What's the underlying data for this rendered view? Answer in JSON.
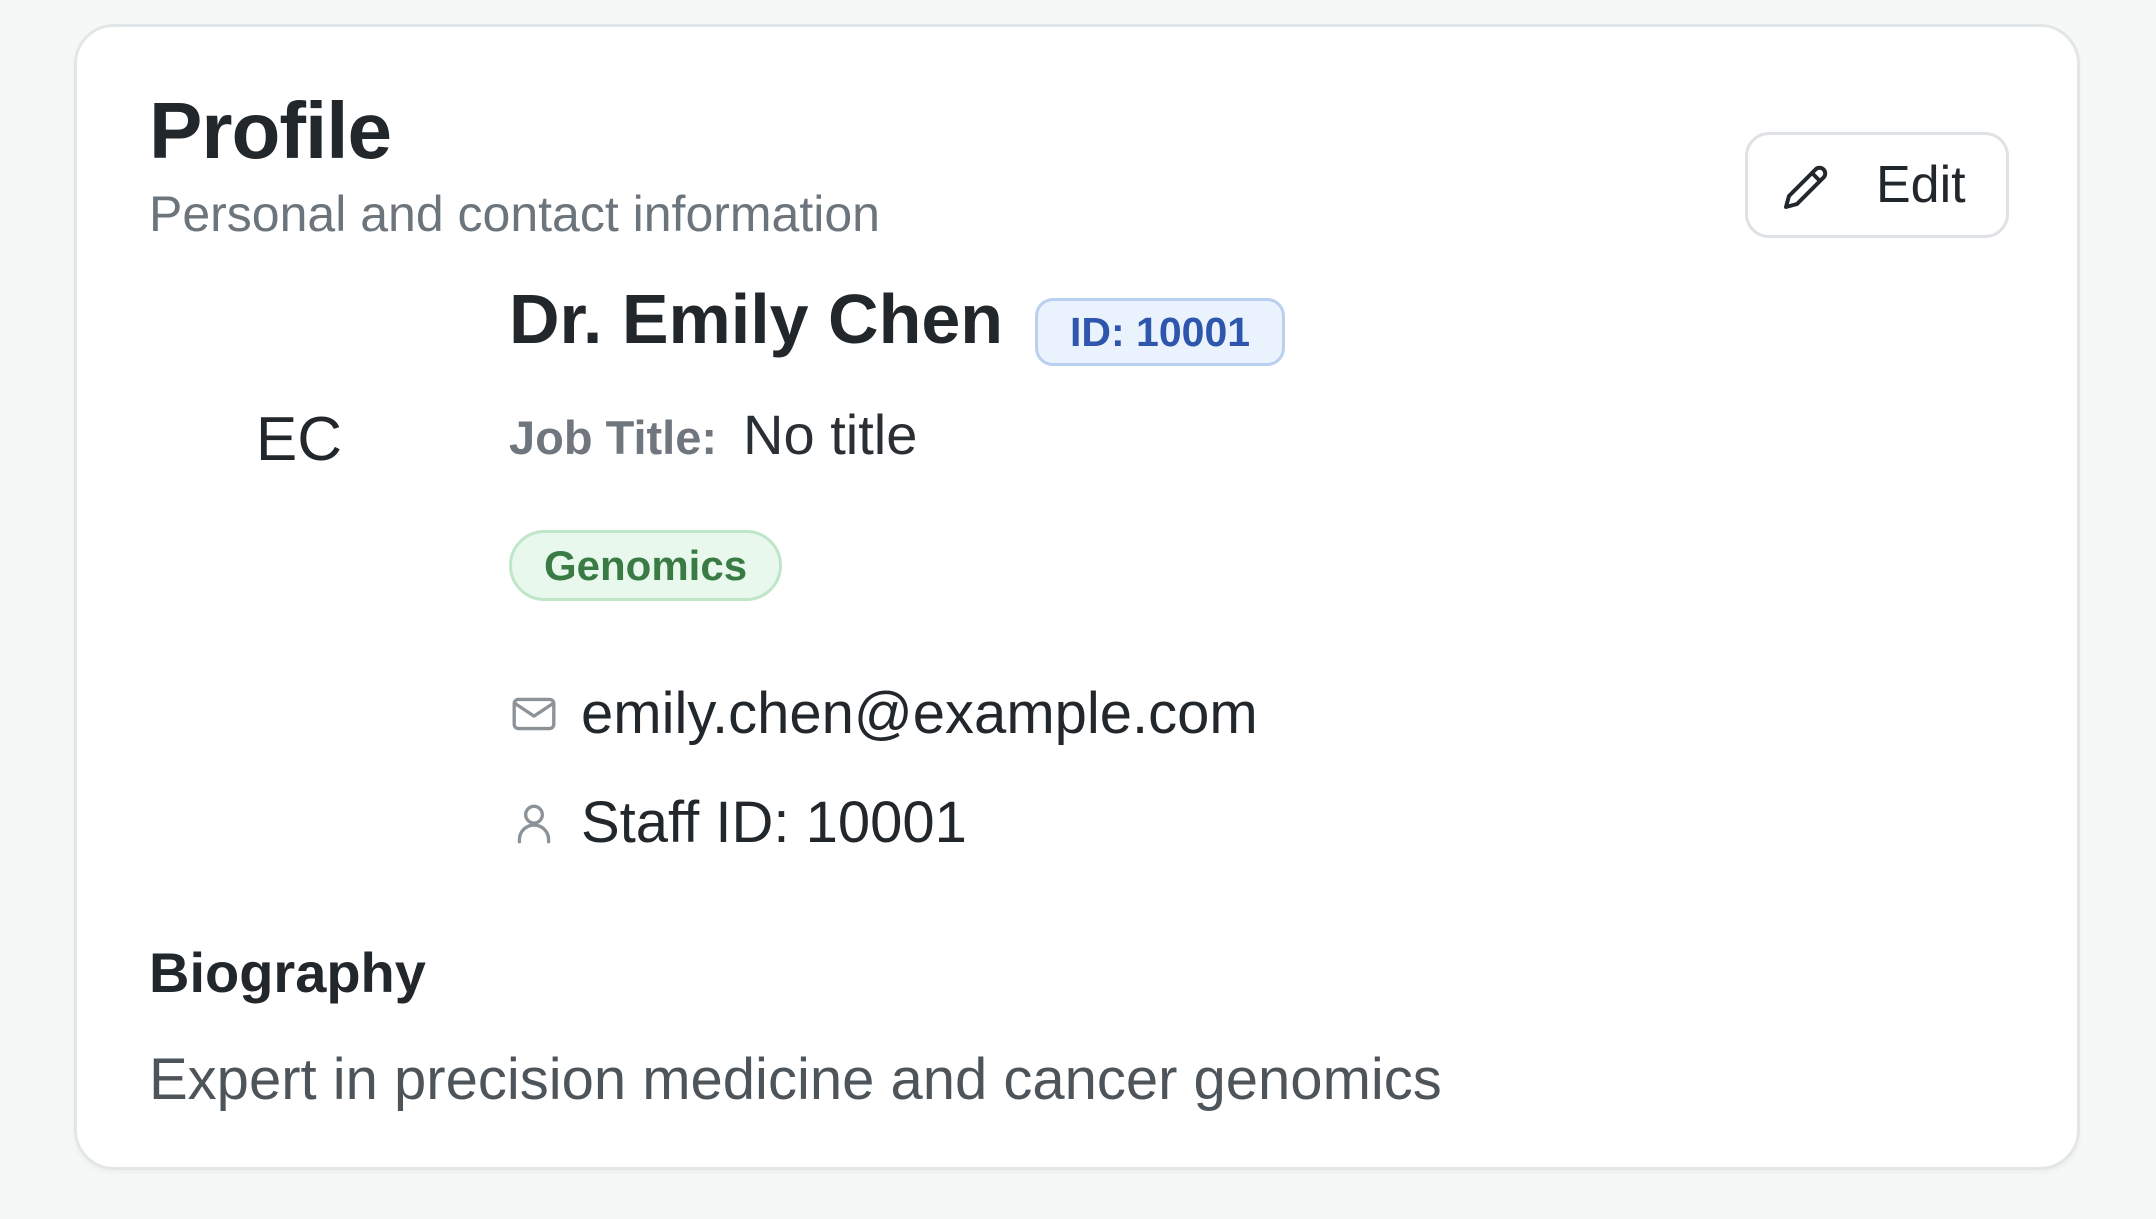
{
  "header": {
    "title": "Profile",
    "subtitle": "Personal and contact information",
    "edit_label": "Edit",
    "edit_icon": "pencil-icon"
  },
  "profile": {
    "initials": "EC",
    "name": "Dr. Emily Chen",
    "id_badge": "ID: 10001",
    "job_title_label": "Job Title:",
    "job_title_value": "No title",
    "department": "Genomics",
    "email": "emily.chen@example.com",
    "email_icon": "mail-icon",
    "staff_id": "Staff ID: 10001",
    "staff_icon": "user-icon"
  },
  "biography": {
    "heading": "Biography",
    "text": "Expert in precision medicine and cancer genomics"
  },
  "colors": {
    "id_badge_bg": "#eaf2fd",
    "id_badge_text": "#2e56ad",
    "tag_bg": "#e9f8ec",
    "tag_text": "#3a7a44"
  }
}
